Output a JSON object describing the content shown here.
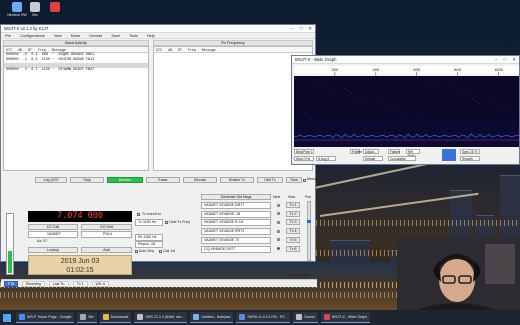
{
  "desktop": {
    "icons": [
      {
        "label": "Neutron SW",
        "color": "#6ea8ff"
      },
      {
        "label": "Bin",
        "color": "#c7cbd2"
      },
      {
        "label": "",
        "color": "#e04040"
      }
    ]
  },
  "main_window": {
    "title": "WSJT-X v2.1.2 by K1JT",
    "menus": [
      "File",
      "Configurations",
      "View",
      "Mode",
      "Decode",
      "Save",
      "Tools",
      "Help"
    ],
    "band_activity_title": "Band Activity",
    "rx_frequency_title": "Rx Frequency",
    "col_headers": [
      "UTC",
      "dB",
      "DT",
      "Freq",
      "Message"
    ],
    "band_rows": [
      {
        "text": "000000  -5  0.4  006  ~  R4QMZ RE0ADZ KN51",
        "selected": false
      },
      {
        "text": "000000  -1  0.3  1150 ~  DX4IDN KG5ND FN13",
        "selected": false
      },
      {
        "text": "",
        "selected": true
      },
      {
        "text": "000000   2  0.7  1150 ~  DF4AMW KD2DC FN07",
        "selected": false
      }
    ],
    "buttons": {
      "log_qso": "Log QSO",
      "stop": "Stop",
      "monitor": "Monitor",
      "erase": "Erase",
      "decode": "Decode",
      "enable_tx": "Enable Tx",
      "halt_tx": "Halt Tx",
      "tune": "Tune",
      "menus": "Menus"
    },
    "frequency": "7.074 000",
    "dx_call_label": "DX Call",
    "dx_grid_label": "DX Grid",
    "dx_call_value": "VA3MET",
    "dx_grid_value": "FN14",
    "az_label": "Az: 57",
    "dist_label": "",
    "lookup_label": "Lookup",
    "add_label": "Add",
    "tx_even_label": "Tx even/1st",
    "tx_freq_value": "Tx  1150 Hz",
    "rx_freq_value": "Rx  1150 Hz",
    "hold_tx_label": "Hold Tx Freq",
    "report_value": "Report -18",
    "auto_seq_label": "Auto Seq",
    "call_1st_label": "Call 1st",
    "generate_label": "Generate Std Msgs",
    "next_label": "Next",
    "now_label": "Now",
    "pwr_label": "Pwr",
    "messages": [
      {
        "text": "VA3MET VE4MOE DR77",
        "tx": "Tx 1",
        "on": false
      },
      {
        "text": "VA3MET VE4MOE -18",
        "tx": "Tx 2",
        "on": false
      },
      {
        "text": "VA3MET VE4MOE R-18",
        "tx": "Tx 3",
        "on": false
      },
      {
        "text": "VA3MET VE4MOE RR73",
        "tx": "Tx 4",
        "on": false
      },
      {
        "text": "VA3MET VE4MOE 73",
        "tx": "Tx 5",
        "on": false
      },
      {
        "text": "CQ VE4MOE DR77",
        "tx": "Tx 6",
        "on": true
      }
    ],
    "date": "2019 Jun 03",
    "time": "01:02:15",
    "db_label": "60 dB",
    "status": [
      "FT8",
      "Receiving",
      "Last Tx: ",
      "Tx 1",
      "WD: 6"
    ],
    "corner_status": "0/15  WD:6m"
  },
  "wide_graph": {
    "title": "WSJT-X - Wide Graph",
    "ticks": [
      "200",
      "400",
      "600",
      "800",
      "1000"
    ],
    "controls": [
      "Bins/Pixel 1",
      "Start 0 Hz",
      "Palette",
      "Adjust...",
      "Flatten",
      "Ref Spec",
      "Spec 25 %",
      "N Avg 5",
      "Default",
      "Cumulative",
      "Smooth"
    ],
    "split_label": "Split",
    "tuning": 1150
  },
  "taskbar": {
    "items": [
      {
        "label": "WSJT Home Page - Google",
        "color": "#4a8af4"
      },
      {
        "label": "Bin",
        "color": "#a0a8b4"
      },
      {
        "label": "Downloads",
        "color": "#e6b84a"
      },
      {
        "label": "OBS 21.1.2 (64bit, win...",
        "color": "#bfbfbf"
      },
      {
        "label": "Untitled - Notepad",
        "color": "#7fb3e6"
      },
      {
        "label": "SDR# v1.0.0.1700 - RT...",
        "color": "#5b8bd1"
      },
      {
        "label": "Sound",
        "color": "#c0c0c0"
      },
      {
        "label": "WSJT-X - Wide Graph",
        "color": "#d94848"
      }
    ]
  }
}
